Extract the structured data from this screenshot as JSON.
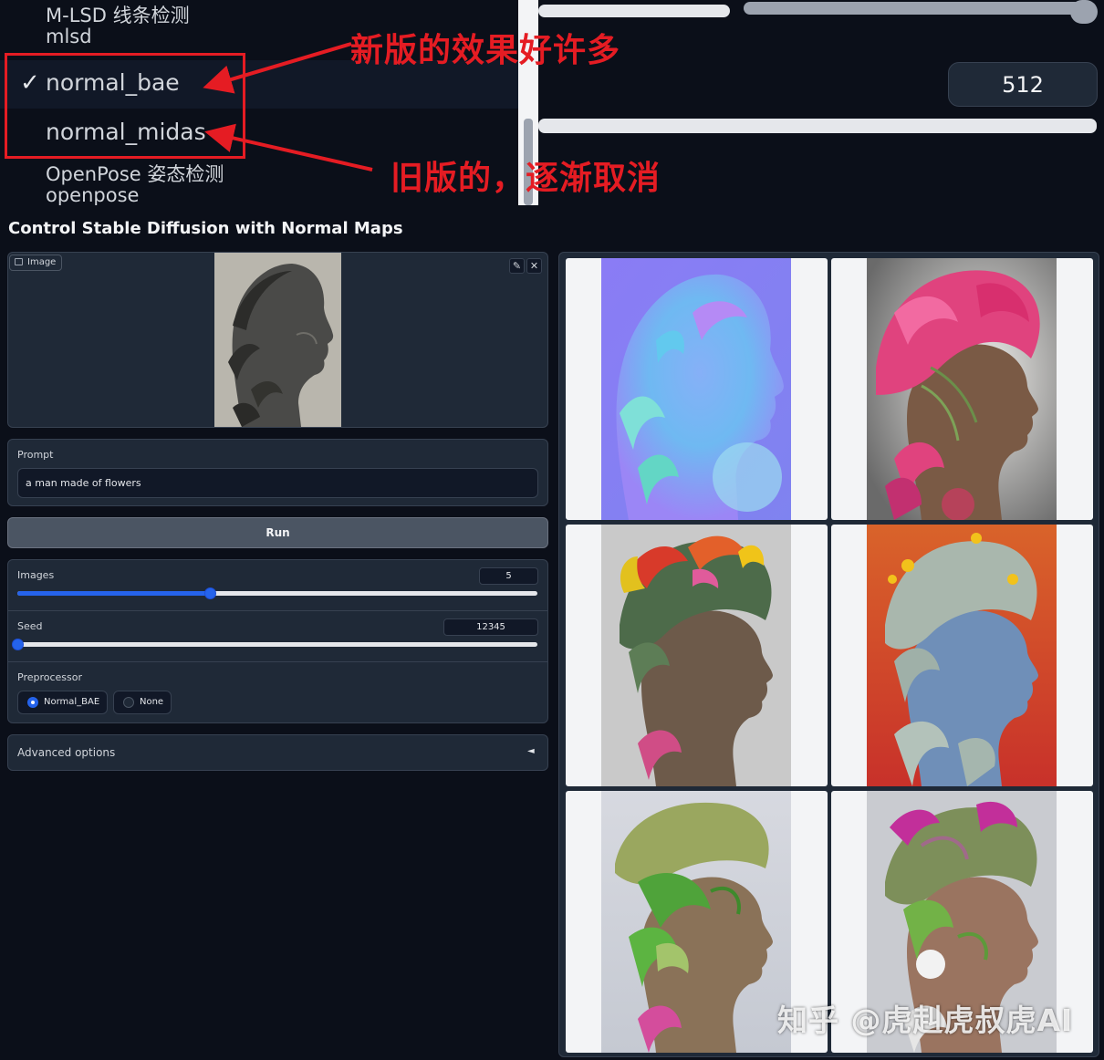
{
  "dropdown": {
    "items": [
      {
        "label": "M-LSD 线条检测",
        "value": "mlsd"
      },
      {
        "label": "normal_bae",
        "selected": true
      },
      {
        "label": "normal_midas"
      },
      {
        "label": "OpenPose 姿态检测",
        "value": "openpose"
      }
    ],
    "check_glyph": "✓",
    "resolution_value": "512"
  },
  "annotations": {
    "new": "新版的效果好许多",
    "old": "旧版的，逐渐取消"
  },
  "app": {
    "title": "Control Stable Diffusion with Normal Maps",
    "image_label": "Image",
    "prompt_label": "Prompt",
    "prompt_value": "a man made of flowers",
    "run_label": "Run",
    "images_label": "Images",
    "images_value": "5",
    "images_fraction": 0.37,
    "seed_label": "Seed",
    "seed_value": "12345",
    "seed_fraction": 0.0,
    "preprocessor_label": "Preprocessor",
    "preprocessor_options": [
      "Normal_BAE",
      "None"
    ],
    "preprocessor_selected": "Normal_BAE",
    "advanced_label": "Advanced options",
    "advanced_caret": "◄"
  },
  "gallery": {
    "items": [
      {
        "name": "normal-map-output",
        "kind": "normal-map"
      },
      {
        "name": "flower-head-pink",
        "kind": "flowers"
      },
      {
        "name": "flower-head-green-red",
        "kind": "flowers"
      },
      {
        "name": "flower-head-blue-orange",
        "kind": "flowers"
      },
      {
        "name": "flower-head-green-white",
        "kind": "flowers"
      },
      {
        "name": "flower-head-magenta",
        "kind": "flowers"
      }
    ]
  },
  "watermark": "知乎 @虎赳虎叔虎AI",
  "colors": {
    "accent": "#2563eb",
    "annotation_red": "#e51c23",
    "background": "#0b0f19",
    "panel": "#1f2937"
  },
  "icons": [
    "checkmark-icon",
    "image-icon",
    "pencil-icon",
    "close-icon",
    "caret-left-icon",
    "radio-icon"
  ]
}
